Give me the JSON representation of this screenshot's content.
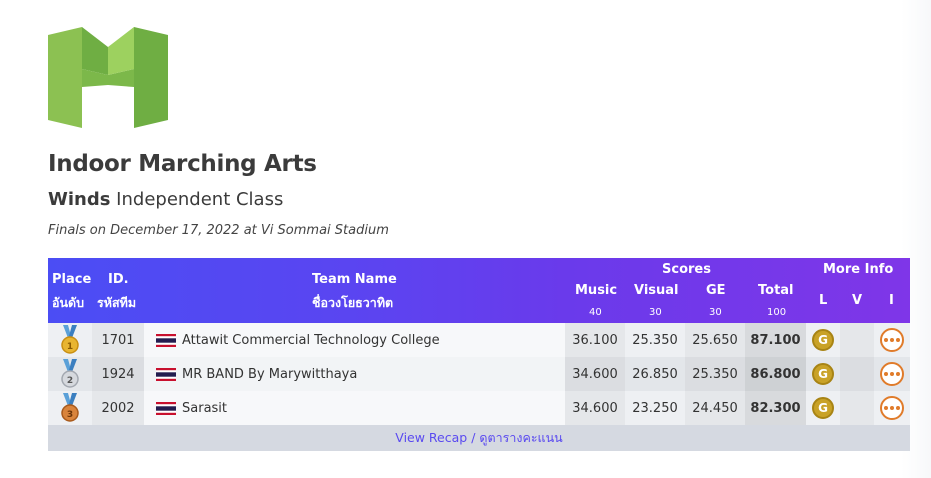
{
  "header": {
    "logo_icon": "indoor-marching-arts-logo",
    "title": "Indoor Marching Arts",
    "subtitle_bold": "Winds",
    "subtitle_rest": "Independent Class",
    "event_line": "Finals on December 17, 2022 at Vi Sommai Stadium"
  },
  "table": {
    "headers": {
      "place": "Place",
      "place_th": "อันดับ",
      "id": "ID.",
      "id_th": "รหัสทีม",
      "team": "Team Name",
      "team_th": "ชื่อวงโยธวาทิต",
      "scores": "Scores",
      "music": "Music",
      "music_max": "40",
      "visual": "Visual",
      "visual_max": "30",
      "ge": "GE",
      "ge_max": "30",
      "total": "Total",
      "total_max": "100",
      "more_info": "More Info",
      "l": "L",
      "v": "V",
      "i": "I"
    },
    "rows": [
      {
        "place_icon": "gold-medal-icon",
        "place": "1",
        "id": "1701",
        "flag_icon": "thailand-flag-icon",
        "team": "Attawit Commercial Technology College",
        "music": "36.100",
        "visual": "25.350",
        "ge": "25.650",
        "total": "87.100",
        "award": "G"
      },
      {
        "place_icon": "silver-medal-icon",
        "place": "2",
        "id": "1924",
        "flag_icon": "thailand-flag-icon",
        "team": "MR BAND By Marywitthaya",
        "music": "34.600",
        "visual": "26.850",
        "ge": "25.350",
        "total": "86.800",
        "award": "G"
      },
      {
        "place_icon": "bronze-medal-icon",
        "place": "3",
        "id": "2002",
        "flag_icon": "thailand-flag-icon",
        "team": "Sarasit",
        "music": "34.600",
        "visual": "23.250",
        "ge": "24.450",
        "total": "82.300",
        "award": "G"
      }
    ],
    "footer_link": "View Recap / ดูตารางคะแนน"
  },
  "colors": {
    "header_gradient_start": "#4b4df4",
    "header_gradient_end": "#7f36e8",
    "logo_green": "#8cc152",
    "award_gold": "#c9a227",
    "more_orange": "#e07b2a"
  }
}
